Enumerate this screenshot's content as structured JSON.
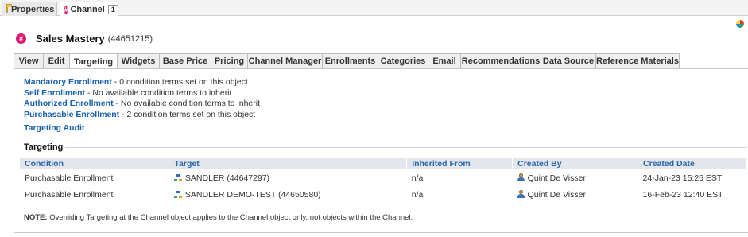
{
  "object_tabs": [
    {
      "label": "Properties"
    },
    {
      "label": "Channel",
      "badge": "1"
    }
  ],
  "header": {
    "title": "Sales Mastery",
    "id": "(44651215)"
  },
  "tabs": [
    {
      "label": "View"
    },
    {
      "label": "Edit"
    },
    {
      "label": "Targeting",
      "active": true
    },
    {
      "label": "Widgets"
    },
    {
      "label": "Base Price"
    },
    {
      "label": "Pricing"
    },
    {
      "label": "Channel Manager"
    },
    {
      "label": "Enrollments"
    },
    {
      "label": "Categories"
    },
    {
      "label": "Email"
    },
    {
      "label": "Recommendations"
    },
    {
      "label": "Data Source"
    },
    {
      "label": "Reference Materials"
    }
  ],
  "enrollment_links": [
    {
      "label": "Mandatory Enrollment",
      "desc": " - 0 condition terms set on this object"
    },
    {
      "label": "Self Enrollment",
      "desc": " - No available condition terms to inherit"
    },
    {
      "label": "Authorized Enrollment",
      "desc": " - No available condition terms to inherit"
    },
    {
      "label": "Purchasable Enrollment",
      "desc": " - 2 condition terms set on this object"
    }
  ],
  "targeting_audit": "Targeting Audit",
  "section_title": "Targeting",
  "table": {
    "columns": [
      "Condition",
      "Target",
      "Inherited From",
      "Created By",
      "Created Date"
    ],
    "rows": [
      {
        "condition": "Purchasable Enrollment",
        "target": "SANDLER (44647297)",
        "inherited_from": "n/a",
        "created_by": "Quint De Visser",
        "created_date": "24-Jan-23 15:26 EST"
      },
      {
        "condition": "Purchasable Enrollment",
        "target": "SANDLER DEMO-TEST (44650580)",
        "inherited_from": "n/a",
        "created_by": "Quint De Visser",
        "created_date": "16-Feb-23 12:40 EST"
      }
    ]
  },
  "note": {
    "label": "NOTE:",
    "text": " Overriding Targeting at the Channel object applies to the Channel object only, not objects within the Channel."
  },
  "colors": {
    "link": "#1a62b0",
    "channel_icon": "#e0196e",
    "table_header_bg": "#e3e6ea"
  }
}
